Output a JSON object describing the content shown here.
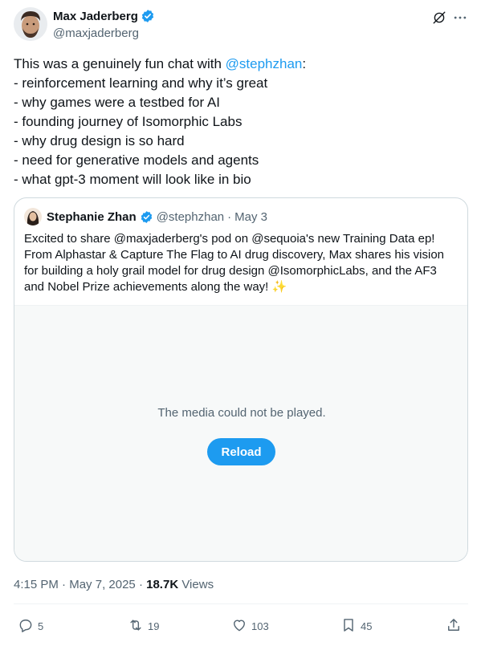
{
  "author": {
    "name": "Max Jaderberg",
    "handle": "@maxjaderberg"
  },
  "tweet": {
    "lines": [
      {
        "prefix": "This was a genuinely fun chat with ",
        "mention": "@stephzhan",
        "suffix": ":"
      },
      {
        "text": "- reinforcement learning and why it’s great"
      },
      {
        "text": "- why games were a testbed for AI"
      },
      {
        "text": "- founding journey of Isomorphic Labs"
      },
      {
        "text": "- why drug design is so hard"
      },
      {
        "text": "- need for generative models and agents"
      },
      {
        "text": "- what gpt-3 moment will look like in bio"
      }
    ]
  },
  "quote": {
    "name": "Stephanie Zhan",
    "handle": "@stephzhan",
    "separator": "·",
    "date": "May 3",
    "lines": [
      "Excited to share @maxjaderberg's pod on @sequoia's new Training Data ep!",
      "From Alphastar & Capture The Flag to AI drug discovery, Max shares his vision",
      "for building a holy grail model for drug design @IsomorphicLabs, and the AF3",
      "and Nobel Prize achievements along the way! ✨"
    ],
    "media": {
      "message": "The media could not be played.",
      "reload_label": "Reload"
    }
  },
  "meta": {
    "time": "4:15 PM",
    "separator": " · ",
    "date": "May 7, 2025",
    "views_count": "18.7K",
    "views_label": "Views"
  },
  "actions": {
    "replies": "5",
    "reposts": "19",
    "likes": "103",
    "bookmarks": "45"
  },
  "colors": {
    "accent": "#1d9bf0",
    "text": "#0f1419",
    "secondary": "#536471",
    "border": "#cfd9de"
  },
  "icons": [
    "verified-badge-icon",
    "grok-icon",
    "more-icon",
    "reply-icon",
    "repost-icon",
    "like-icon",
    "bookmark-icon",
    "share-icon"
  ]
}
